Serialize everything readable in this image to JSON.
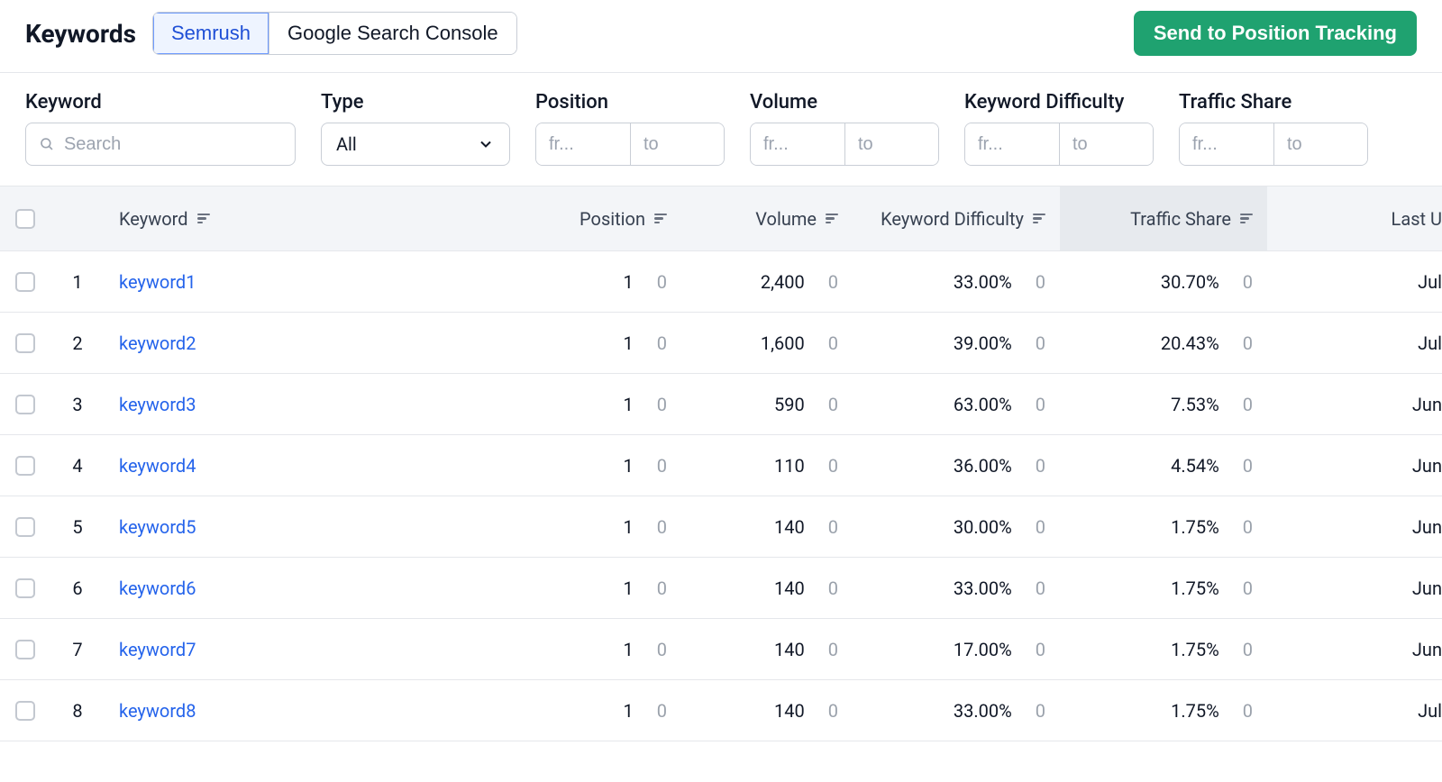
{
  "header": {
    "title": "Keywords",
    "tabs": [
      {
        "label": "Semrush",
        "active": true
      },
      {
        "label": "Google Search Console",
        "active": false
      }
    ],
    "ctaLabel": "Send to Position Tracking"
  },
  "filters": {
    "keyword": {
      "label": "Keyword",
      "placeholder": "Search"
    },
    "type": {
      "label": "Type",
      "value": "All"
    },
    "position": {
      "label": "Position",
      "from": "fr...",
      "to": "to"
    },
    "volume": {
      "label": "Volume",
      "from": "fr...",
      "to": "to"
    },
    "kd": {
      "label": "Keyword Difficulty",
      "from": "fr...",
      "to": "to"
    },
    "ts": {
      "label": "Traffic Share",
      "from": "fr...",
      "to": "to"
    }
  },
  "columns": {
    "keyword": "Keyword",
    "position": "Position",
    "volume": "Volume",
    "kd": "Keyword Difficulty",
    "ts": "Traffic Share",
    "last": "Last U"
  },
  "rows": [
    {
      "idx": "1",
      "keyword": "keyword1",
      "pos": "1",
      "posDelta": "0",
      "vol": "2,400",
      "volDelta": "0",
      "kd": "33.00%",
      "kdDelta": "0",
      "ts": "30.70%",
      "tsDelta": "0",
      "last": "Jul"
    },
    {
      "idx": "2",
      "keyword": "keyword2",
      "pos": "1",
      "posDelta": "0",
      "vol": "1,600",
      "volDelta": "0",
      "kd": "39.00%",
      "kdDelta": "0",
      "ts": "20.43%",
      "tsDelta": "0",
      "last": "Jul"
    },
    {
      "idx": "3",
      "keyword": "keyword3",
      "pos": "1",
      "posDelta": "0",
      "vol": "590",
      "volDelta": "0",
      "kd": "63.00%",
      "kdDelta": "0",
      "ts": "7.53%",
      "tsDelta": "0",
      "last": "Jun"
    },
    {
      "idx": "4",
      "keyword": "keyword4",
      "pos": "1",
      "posDelta": "0",
      "vol": "110",
      "volDelta": "0",
      "kd": "36.00%",
      "kdDelta": "0",
      "ts": "4.54%",
      "tsDelta": "0",
      "last": "Jun"
    },
    {
      "idx": "5",
      "keyword": "keyword5",
      "pos": "1",
      "posDelta": "0",
      "vol": "140",
      "volDelta": "0",
      "kd": "30.00%",
      "kdDelta": "0",
      "ts": "1.75%",
      "tsDelta": "0",
      "last": "Jun"
    },
    {
      "idx": "6",
      "keyword": "keyword6",
      "pos": "1",
      "posDelta": "0",
      "vol": "140",
      "volDelta": "0",
      "kd": "33.00%",
      "kdDelta": "0",
      "ts": "1.75%",
      "tsDelta": "0",
      "last": "Jun"
    },
    {
      "idx": "7",
      "keyword": "keyword7",
      "pos": "1",
      "posDelta": "0",
      "vol": "140",
      "volDelta": "0",
      "kd": "17.00%",
      "kdDelta": "0",
      "ts": "1.75%",
      "tsDelta": "0",
      "last": "Jun"
    },
    {
      "idx": "8",
      "keyword": "keyword8",
      "pos": "1",
      "posDelta": "0",
      "vol": "140",
      "volDelta": "0",
      "kd": "33.00%",
      "kdDelta": "0",
      "ts": "1.75%",
      "tsDelta": "0",
      "last": "Jul"
    }
  ]
}
